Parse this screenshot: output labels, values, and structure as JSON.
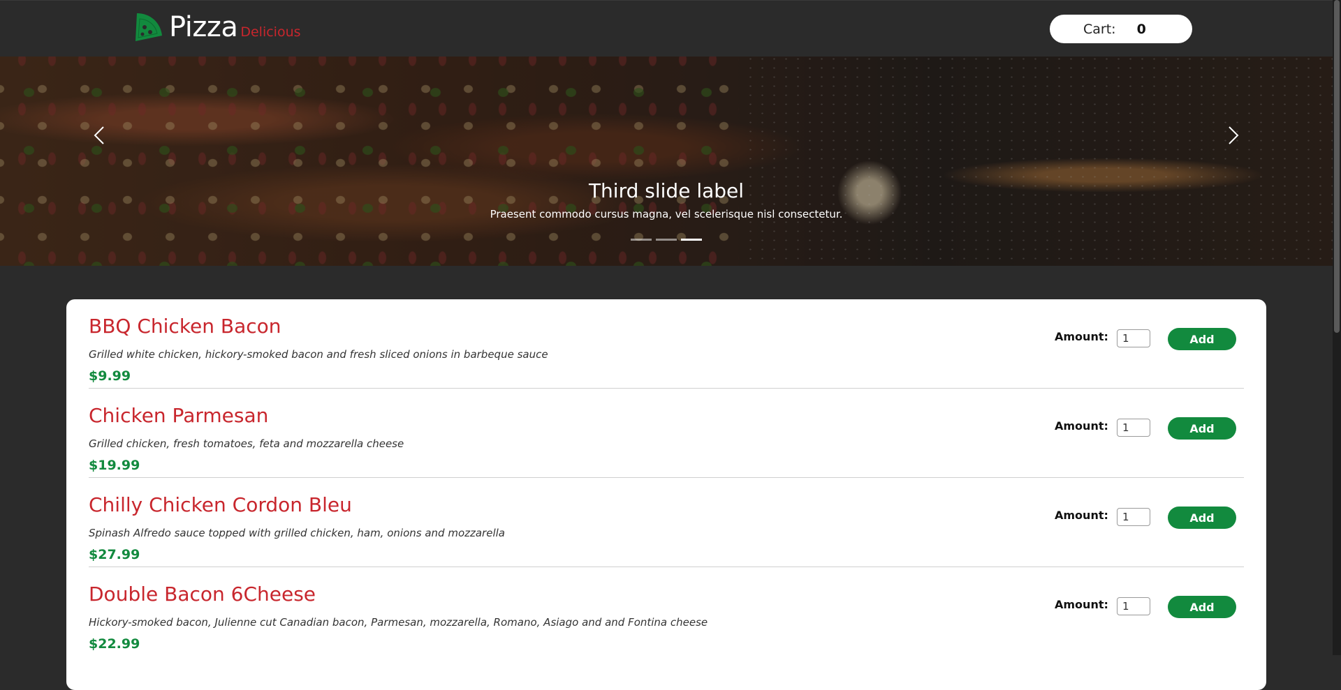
{
  "header": {
    "brand_name": "Pizza",
    "brand_tagline": "Delicious",
    "cart_label": "Cart:",
    "cart_count": "0"
  },
  "carousel": {
    "prev_icon": "chevron-left-icon",
    "next_icon": "chevron-right-icon",
    "title": "Third slide label",
    "subtitle": "Praesent commodo cursus magna, vel scelerisque nisl consectetur.",
    "slide_count": 3,
    "active_slide": 3
  },
  "menu": {
    "amount_label": "Amount:",
    "add_label": "Add",
    "items": [
      {
        "name": "BBQ Chicken Bacon",
        "description": "Grilled white chicken, hickory-smoked bacon and fresh sliced onions in barbeque sauce",
        "price": "$9.99",
        "amount": "1"
      },
      {
        "name": "Chicken Parmesan",
        "description": "Grilled chicken, fresh tomatoes, feta and mozzarella cheese",
        "price": "$19.99",
        "amount": "1"
      },
      {
        "name": "Chilly Chicken Cordon Bleu",
        "description": "Spinash Alfredo sauce topped with grilled chicken, ham, onions and mozzarella",
        "price": "$27.99",
        "amount": "1"
      },
      {
        "name": "Double Bacon 6Cheese",
        "description": "Hickory-smoked bacon, Julienne cut Canadian bacon, Parmesan, mozzarella, Romano, Asiago and and Fontina cheese",
        "price": "$22.99",
        "amount": "1"
      }
    ]
  },
  "colors": {
    "background": "#2b2b2b",
    "brand_red": "#c8262d",
    "brand_green": "#128a3e"
  }
}
